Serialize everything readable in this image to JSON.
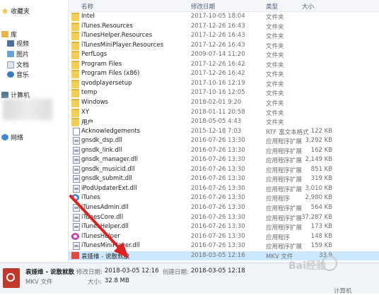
{
  "nav": {
    "favorites": "收藏夹",
    "library": "库",
    "videos": "视频",
    "pictures": "图片",
    "documents": "文档",
    "music": "音乐",
    "computer": "计算机",
    "network": "网络"
  },
  "header": {
    "name": "名称",
    "date": "修改日期",
    "type": "类型",
    "size": "大小"
  },
  "files": [
    {
      "name": "Intel",
      "date": "2017-10-05 18:04",
      "type": "文件夹",
      "size": "",
      "icon": "folder-icon"
    },
    {
      "name": "iTunes.Resources",
      "date": "2017-12-26 16:43",
      "type": "文件夹",
      "size": "",
      "icon": "folder-icon"
    },
    {
      "name": "iTunesHelper.Resources",
      "date": "2017-12-26 16:43",
      "type": "文件夹",
      "size": "",
      "icon": "folder-icon"
    },
    {
      "name": "iTunesMiniPlayer.Resources",
      "date": "2017-12-26 16:43",
      "type": "文件夹",
      "size": "",
      "icon": "folder-icon"
    },
    {
      "name": "PerfLogs",
      "date": "2009-07-14 11:20",
      "type": "文件夹",
      "size": "",
      "icon": "folder-icon"
    },
    {
      "name": "Program Files",
      "date": "2017-12-26 16:42",
      "type": "文件夹",
      "size": "",
      "icon": "folder-icon"
    },
    {
      "name": "Program Files (x86)",
      "date": "2017-12-26 16:42",
      "type": "文件夹",
      "size": "",
      "icon": "folder-icon"
    },
    {
      "name": "qvodplayersetup",
      "date": "2017-10-16 12:19",
      "type": "文件夹",
      "size": "",
      "icon": "folder-icon"
    },
    {
      "name": "temp",
      "date": "2017-10-16 12:05",
      "type": "文件夹",
      "size": "",
      "icon": "folder-icon"
    },
    {
      "name": "Windows",
      "date": "2018-02-01 9:20",
      "type": "文件夹",
      "size": "",
      "icon": "folder-icon"
    },
    {
      "name": "XY",
      "date": "2018-01-11 20:58",
      "type": "文件夹",
      "size": "",
      "icon": "folder-icon"
    },
    {
      "name": "用户",
      "date": "2018-05-05 4:43",
      "type": "文件夹",
      "size": "",
      "icon": "folder-icon"
    },
    {
      "name": "Acknowledgements",
      "date": "2015-12-18 7:03",
      "type": "RTF 富文本格式",
      "size": "122 KB",
      "icon": "document-icon"
    },
    {
      "name": "gnsdk_dsp.dll",
      "date": "2016-07-26 13:30",
      "type": "应用程序扩展",
      "size": "3,292 KB",
      "icon": "dll-icon"
    },
    {
      "name": "gnsdk_link.dll",
      "date": "2016-07-26 13:30",
      "type": "应用程序扩展",
      "size": "162 KB",
      "icon": "dll-icon"
    },
    {
      "name": "gnsdk_manager.dll",
      "date": "2016-07-26 13:30",
      "type": "应用程序扩展",
      "size": "2,149 KB",
      "icon": "dll-icon"
    },
    {
      "name": "gnsdk_musicid.dll",
      "date": "2016-07-26 13:30",
      "type": "应用程序扩展",
      "size": "851 KB",
      "icon": "dll-icon"
    },
    {
      "name": "gnsdk_submit.dll",
      "date": "2016-07-26 13:30",
      "type": "应用程序扩展",
      "size": "319 KB",
      "icon": "dll-icon"
    },
    {
      "name": "iPodUpdaterExt.dll",
      "date": "2016-07-26 13:30",
      "type": "应用程序扩展",
      "size": "3,010 KB",
      "icon": "dll-icon"
    },
    {
      "name": "iTunes",
      "date": "2016-07-26 13:30",
      "type": "应用程序",
      "size": "2,980 KB",
      "icon": "itunes-icon"
    },
    {
      "name": "iTunesAdmin.dll",
      "date": "2016-07-26 13:30",
      "type": "应用程序扩展",
      "size": "564 KB",
      "icon": "dll-icon"
    },
    {
      "name": "iTunesCore.dll",
      "date": "2016-07-26 13:30",
      "type": "应用程序扩展",
      "size": "37,287 KB",
      "icon": "dll-icon"
    },
    {
      "name": "iTunesHelper.dll",
      "date": "2016-07-26 13:30",
      "type": "应用程序扩展",
      "size": "173 KB",
      "icon": "dll-icon"
    },
    {
      "name": "iTunesHelper",
      "date": "2016-07-26 13:30",
      "type": "应用程序",
      "size": "148 KB",
      "icon": "itunes-helper-icon"
    },
    {
      "name": "iTunesMiniPlayer.dll",
      "date": "2016-07-26 13:30",
      "type": "应用程序扩展",
      "size": "159 KB",
      "icon": "dll-icon"
    },
    {
      "name": "袁娅维 - 说散就散",
      "date": "2018-03-05 12:16",
      "type": "MKV 文件",
      "size": "33,9",
      "icon": "mkv-icon",
      "selected": true
    }
  ],
  "details": {
    "filename": "袁娅维 - 说散就散",
    "filetype": "MKV 文件",
    "modified_label": "修改日期:",
    "modified_value": "2018-03-05 12:16",
    "created_label": "创建日期:",
    "created_value": "2018-03-05 12:18",
    "size_label": "大小:",
    "size_value": "32.8 MB"
  },
  "watermark": "Bai经验",
  "statusbar_computer": "计算机",
  "colors": {
    "selected": "#cce8ff",
    "folder": "#f4cf55",
    "arrow": "#e02020"
  }
}
